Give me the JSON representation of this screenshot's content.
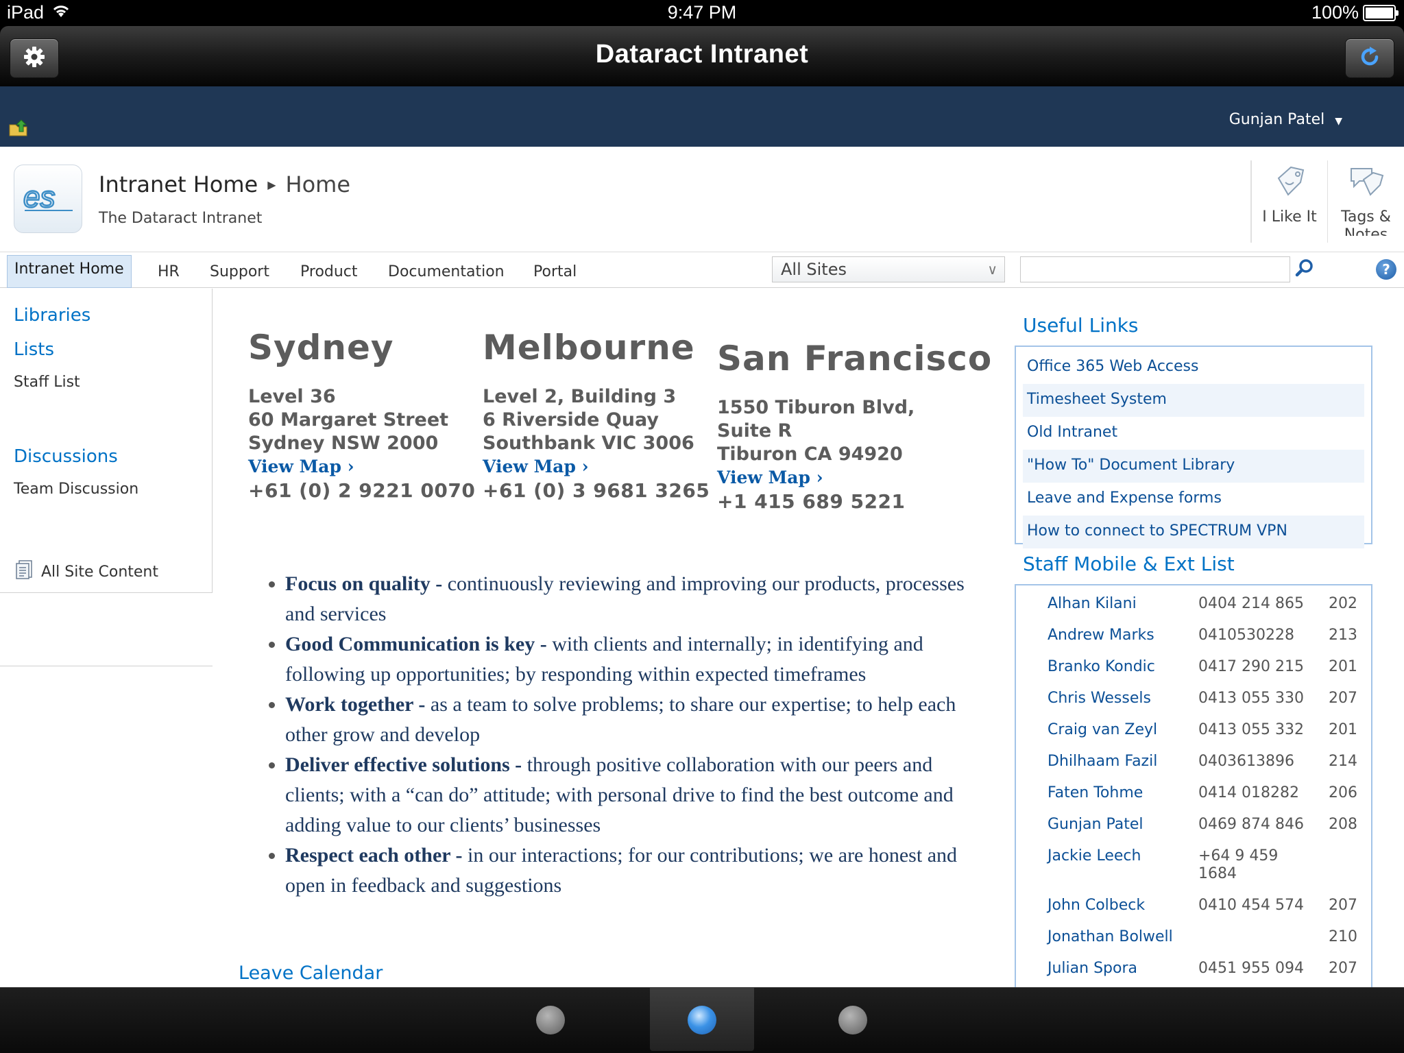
{
  "status": {
    "device": "iPad",
    "time": "9:47 PM",
    "battery": "100%",
    "battery_level": 1.0
  },
  "app": {
    "title": "Dataract Intranet",
    "settings_icon": "gear-icon",
    "refresh_icon": "refresh-icon"
  },
  "suite": {
    "user": "Gunjan Patel"
  },
  "site": {
    "breadcrumb_root": "Intranet Home",
    "breadcrumb_current": "Home",
    "subtitle": "The Dataract Intranet",
    "actions": [
      {
        "label": "I Like It"
      },
      {
        "label": "Tags & Notes"
      }
    ]
  },
  "nav": {
    "tabs": [
      "Intranet Home",
      "HR",
      "Support",
      "Product",
      "Documentation",
      "Portal"
    ],
    "scope": "All Sites",
    "search_placeholder": "",
    "help": "?"
  },
  "quicklaunch": {
    "libraries": "Libraries",
    "lists": "Lists",
    "staff_list": "Staff List",
    "discussions": "Discussions",
    "team_discussion": "Team Discussion",
    "all_site_content": "All Site Content"
  },
  "offices": [
    {
      "city": "Sydney",
      "lines": [
        "Level 36",
        "60 Margaret Street",
        "Sydney NSW 2000"
      ],
      "map": "View Map ›",
      "phone": "+61 (0) 2 9221 0070"
    },
    {
      "city": "Melbourne",
      "lines": [
        "Level 2, Building 3",
        "6 Riverside Quay",
        "Southbank VIC 3006"
      ],
      "map": "View Map ›",
      "phone": "+61 (0) 3 9681 3265"
    },
    {
      "city": "San Francisco",
      "lines": [
        "1550 Tiburon Blvd,",
        "Suite R",
        "Tiburon CA 94920"
      ],
      "map": "View Map ›",
      "phone": "+1 415 689 5221"
    }
  ],
  "values": [
    {
      "title": "Focus on quality -",
      "text": " continuously reviewing and improving our products, processes and services"
    },
    {
      "title": "Good Communication is key -",
      "text": " with clients and internally; in identifying and following up opportunities;  by responding within expected timeframes"
    },
    {
      "title": "Work together -",
      "text": " as a team to solve problems; to share our expertise; to help each other grow and develop"
    },
    {
      "title": "Deliver effective solutions -",
      "text": " through positive collaboration with our peers and clients; with a “can do” attitude; with personal drive to find the best outcome and adding value to our clients’ businesses"
    },
    {
      "title": "Respect each other -",
      "text": " in our interactions; for our contributions; we are honest and  open in feedback and suggestions"
    }
  ],
  "leave_calendar": "Leave Calendar",
  "useful_links": {
    "title": "Useful Links",
    "items": [
      "Office 365 Web Access",
      "Timesheet System",
      "Old Intranet",
      "\"How To\" Document Library",
      "Leave and Expense forms",
      "How to connect to SPECTRUM VPN"
    ]
  },
  "staff": {
    "title": "Staff Mobile & Ext List",
    "rows": [
      {
        "name": "Alhan Kilani",
        "phone": "0404 214 865",
        "ext": "202"
      },
      {
        "name": "Andrew Marks",
        "phone": "0410530228",
        "ext": "213"
      },
      {
        "name": "Branko Kondic",
        "phone": "0417 290 215",
        "ext": "201"
      },
      {
        "name": "Chris Wessels",
        "phone": "0413 055 330",
        "ext": "207"
      },
      {
        "name": "Craig van Zeyl",
        "phone": "0413 055 332",
        "ext": "201"
      },
      {
        "name": "Dhilhaam Fazil",
        "phone": "0403613896",
        "ext": "214"
      },
      {
        "name": "Faten Tohme",
        "phone": "0414 018282",
        "ext": "206"
      },
      {
        "name": "Gunjan Patel",
        "phone": "0469 874 846",
        "ext": "208"
      },
      {
        "name": "Jackie Leech",
        "phone": "+64 9 459 1684",
        "ext": ""
      },
      {
        "name": "John Colbeck",
        "phone": "0410 454 574",
        "ext": "207"
      },
      {
        "name": "Jonathan Bolwell",
        "phone": "",
        "ext": "210"
      },
      {
        "name": "Julian Spora",
        "phone": "0451 955 094",
        "ext": "207"
      }
    ]
  },
  "dock": {
    "pages": 3,
    "active_page": 2
  }
}
